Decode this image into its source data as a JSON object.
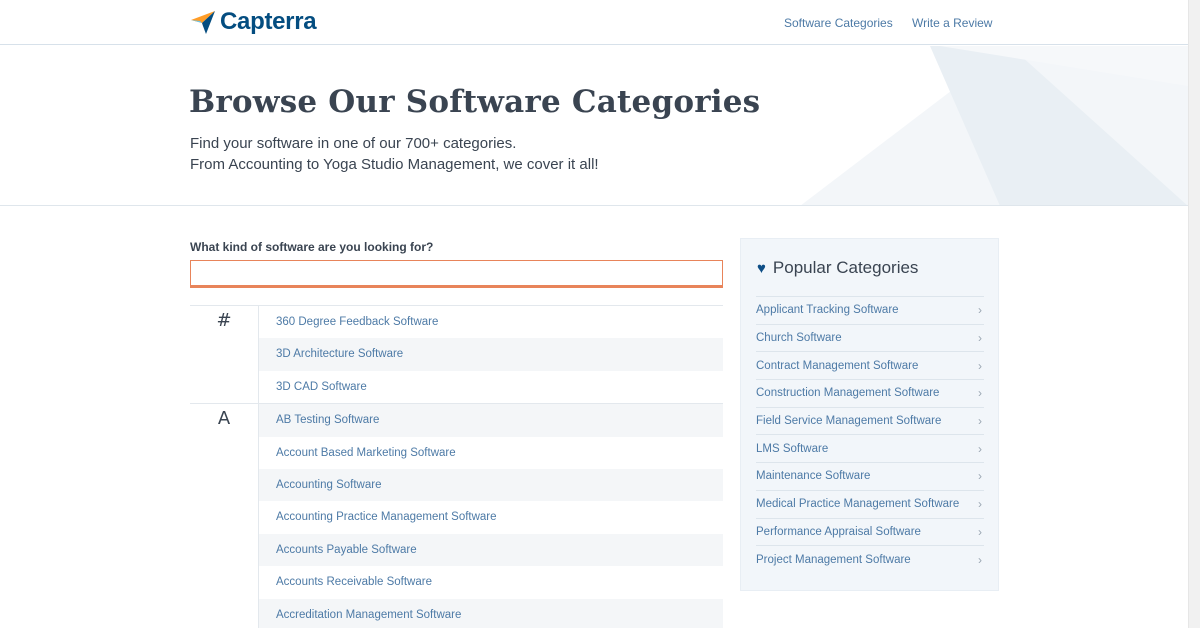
{
  "header": {
    "brand": "Capterra",
    "nav": [
      "Software Categories",
      "Write a Review"
    ]
  },
  "hero": {
    "title": "Browse Our Software Categories",
    "line1": "Find your software in one of our 700+ categories.",
    "line2": "From Accounting to Yoga Studio Management, we cover it all!"
  },
  "search": {
    "label": "What kind of software are you looking for?",
    "value": "",
    "placeholder": ""
  },
  "categories": [
    {
      "letter": "#",
      "items": [
        "360 Degree Feedback Software",
        "3D Architecture Software",
        "3D CAD Software"
      ]
    },
    {
      "letter": "A",
      "items": [
        "AB Testing Software",
        "Account Based Marketing Software",
        "Accounting Software",
        "Accounting Practice Management Software",
        "Accounts Payable Software",
        "Accounts Receivable Software",
        "Accreditation Management Software"
      ]
    }
  ],
  "popular": {
    "title": "Popular Categories",
    "items": [
      "Applicant Tracking Software",
      "Church Software",
      "Contract Management Software",
      "Construction Management Software",
      "Field Service Management Software",
      "LMS Software",
      "Maintenance Software",
      "Medical Practice Management Software",
      "Performance Appraisal Software",
      "Project Management Software"
    ]
  },
  "colors": {
    "brand": "#044d80",
    "link": "#4d7aa6",
    "accent_orange": "#e8845a",
    "sidebar_bg": "#f2f6fa"
  },
  "icons": {
    "logo": "capterra-arrow-icon",
    "heart": "heart-icon",
    "chevron": "chevron-right-icon"
  }
}
